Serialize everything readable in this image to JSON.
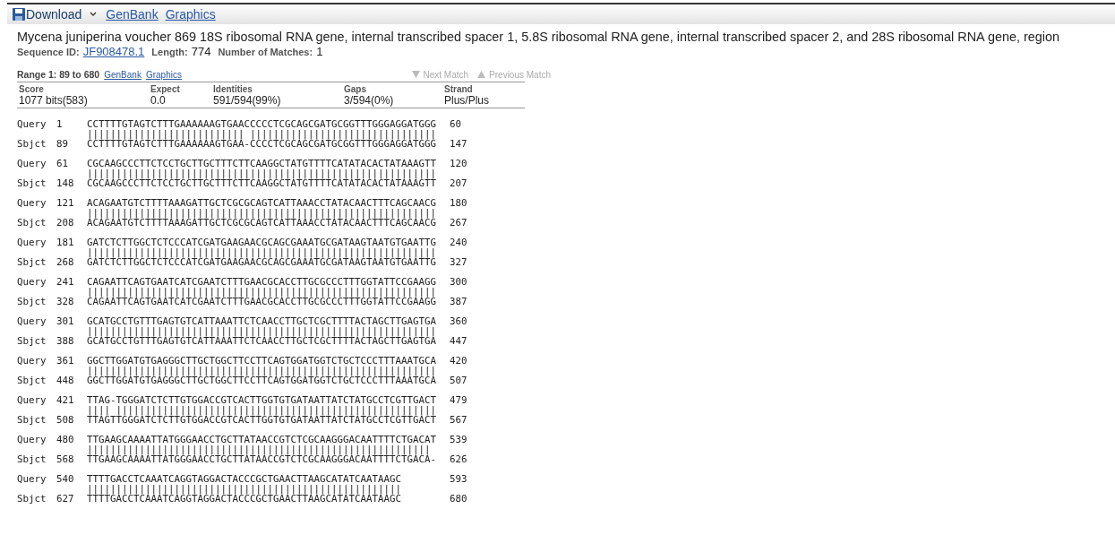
{
  "toolbar": {
    "items": [
      {
        "kind": "download",
        "label": "Download"
      },
      {
        "kind": "link",
        "label": "GenBank"
      },
      {
        "kind": "link",
        "label": "Graphics"
      }
    ]
  },
  "title": "Mycena juniperina voucher 869 18S ribosomal RNA gene, internal transcribed spacer 1, 5.8S ribosomal RNA gene, internal transcribed spacer 2, and 28S ribosomal RNA gene, region",
  "meta": [
    {
      "label": "Sequence ID:",
      "value": "JF908478.1",
      "kind": "link"
    },
    {
      "label": "Length:",
      "value": "774",
      "kind": "text"
    },
    {
      "label": "Number of Matches:",
      "value": "1",
      "kind": "text"
    }
  ],
  "range": {
    "label": "Range 1: 89 to 680",
    "links": [
      "GenBank",
      "Graphics"
    ],
    "nav": [
      {
        "label": "Next Match",
        "kind": "down",
        "disabled": true
      },
      {
        "label": "Previous Match",
        "kind": "up",
        "disabled": true
      }
    ]
  },
  "stats": {
    "columns": [
      "Score",
      "Expect",
      "Identities",
      "Gaps",
      "Strand"
    ],
    "values": [
      "1077 bits(583)",
      "0.0",
      "591/594(99%)",
      "3/594(0%)",
      "Plus/Plus"
    ]
  },
  "alignment": [
    {
      "query": {
        "label": "Query",
        "start": "1",
        "seq": "CCTTTTGTAGTCTTTGAAAAAAGTGAACCCCCTCGCAGCGATGCGGTTTGGGAGGATGGG",
        "end": "60"
      },
      "midline": "||||||||||||||||||||||||||| ||||||||||||||||||||||||||||||||",
      "sbjct": {
        "label": "Sbjct",
        "start": "89",
        "seq": "CCTTTTGTAGTCTTTGAAAAAAGTGAA-CCCCTCGCAGCGATGCGGTTTGGGAGGATGGG",
        "end": "147"
      }
    },
    {
      "query": {
        "label": "Query",
        "start": "61",
        "seq": "CGCAAGCCCTTCTCCTGCTTGCTTTCTTCAAGGCTATGTTTTCATATACACTATAAAGTT",
        "end": "120"
      },
      "midline": "||||||||||||||||||||||||||||||||||||||||||||||||||||||||||||",
      "sbjct": {
        "label": "Sbjct",
        "start": "148",
        "seq": "CGCAAGCCCTTCTCCTGCTTGCTTTCTTCAAGGCTATGTTTTCATATACACTATAAAGTT",
        "end": "207"
      }
    },
    {
      "query": {
        "label": "Query",
        "start": "121",
        "seq": "ACAGAATGTCTTTTAAAGATTGCTCGCGCAGTCATTAAACCTATACAACTTTCAGCAACG",
        "end": "180"
      },
      "midline": "||||||||||||||||||||||||||||||||||||||||||||||||||||||||||||",
      "sbjct": {
        "label": "Sbjct",
        "start": "208",
        "seq": "ACAGAATGTCTTTTAAAGATTGCTCGCGCAGTCATTAAACCTATACAACTTTCAGCAACG",
        "end": "267"
      }
    },
    {
      "query": {
        "label": "Query",
        "start": "181",
        "seq": "GATCTCTTGGCTCTCCCATCGATGAAGAACGCAGCGAAATGCGATAAGTAATGTGAATTG",
        "end": "240"
      },
      "midline": "||||||||||||||||||||||||||||||||||||||||||||||||||||||||||||",
      "sbjct": {
        "label": "Sbjct",
        "start": "268",
        "seq": "GATCTCTTGGCTCTCCCATCGATGAAGAACGCAGCGAAATGCGATAAGTAATGTGAATTG",
        "end": "327"
      }
    },
    {
      "query": {
        "label": "Query",
        "start": "241",
        "seq": "CAGAATTCAGTGAATCATCGAATCTTTGAACGCACCTTGCGCCCTTTGGTATTCCGAAGG",
        "end": "300"
      },
      "midline": "||||||||||||||||||||||||||||||||||||||||||||||||||||||||||||",
      "sbjct": {
        "label": "Sbjct",
        "start": "328",
        "seq": "CAGAATTCAGTGAATCATCGAATCTTTGAACGCACCTTGCGCCCTTTGGTATTCCGAAGG",
        "end": "387"
      }
    },
    {
      "query": {
        "label": "Query",
        "start": "301",
        "seq": "GCATGCCTGTTTGAGTGTCATTAAATTCTCAACCTTGCTCGCTTTTACTAGCTTGAGTGA",
        "end": "360"
      },
      "midline": "||||||||||||||||||||||||||||||||||||||||||||||||||||||||||||",
      "sbjct": {
        "label": "Sbjct",
        "start": "388",
        "seq": "GCATGCCTGTTTGAGTGTCATTAAATTCTCAACCTTGCTCGCTTTTACTAGCTTGAGTGA",
        "end": "447"
      }
    },
    {
      "query": {
        "label": "Query",
        "start": "361",
        "seq": "GGCTTGGATGTGAGGGCTTGCTGGCTTCCTTCAGTGGATGGTCTGCTCCCTTTAAATGCA",
        "end": "420"
      },
      "midline": "||||||||||||||||||||||||||||||||||||||||||||||||||||||||||||",
      "sbjct": {
        "label": "Sbjct",
        "start": "448",
        "seq": "GGCTTGGATGTGAGGGCTTGCTGGCTTCCTTCAGTGGATGGTCTGCTCCCTTTAAATGCA",
        "end": "507"
      }
    },
    {
      "query": {
        "label": "Query",
        "start": "421",
        "seq": "TTAG-TGGGATCTCTTGTGGACCGTCACTTGGTGTGATAATTATCTATGCCTCGTTGACT",
        "end": "479"
      },
      "midline": "|||| |||||||||||||||||||||||||||||||||||||||||||||||||||||||",
      "sbjct": {
        "label": "Sbjct",
        "start": "508",
        "seq": "TTAGTTGGGATCTCTTGTGGACCGTCACTTGGTGTGATAATTATCTATGCCTCGTTGACT",
        "end": "567"
      }
    },
    {
      "query": {
        "label": "Query",
        "start": "480",
        "seq": "TTGAAGCAAAATTATGGGAACCTGCTTATAACCGTCTCGCAAGGGACAATTTTCTGACAT",
        "end": "539"
      },
      "midline": "||||||||||||||||||||||||||||||||||||||||||||||||||||||||||| ",
      "sbjct": {
        "label": "Sbjct",
        "start": "568",
        "seq": "TTGAAGCAAAATTATGGGAACCTGCTTATAACCGTCTCGCAAGGGACAATTTTCTGACA-",
        "end": "626"
      }
    },
    {
      "query": {
        "label": "Query",
        "start": "540",
        "seq": "TTTTGACCTCAAATCAGGTAGGACTACCCGCTGAACTTAAGCATATCAATAAGC",
        "end": "593"
      },
      "midline": "||||||||||||||||||||||||||||||||||||||||||||||||||||||",
      "sbjct": {
        "label": "Sbjct",
        "start": "627",
        "seq": "TTTTGACCTCAAATCAGGTAGGACTACCCGCTGAACTTAAGCATATCAATAAGC",
        "end": "680"
      }
    }
  ]
}
